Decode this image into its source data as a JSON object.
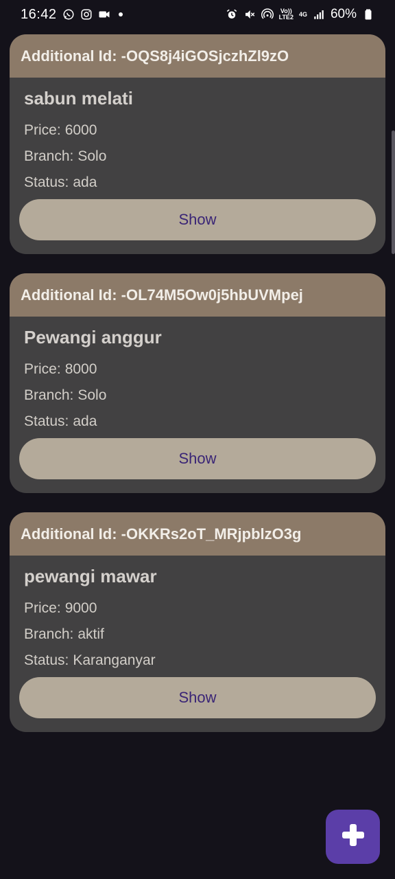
{
  "status_bar": {
    "time": "16:42",
    "network_top": "Vo))",
    "network_bottom": "LTE2",
    "network_gen": "4G",
    "battery": "60%",
    "left_icons": [
      "whatsapp-icon",
      "instagram-icon",
      "video-camera-icon",
      "notification-dot"
    ],
    "right_icons": [
      "alarm-icon",
      "mute-icon",
      "hotspot-icon",
      "signal-icon",
      "battery-icon"
    ]
  },
  "labels": {
    "additional_id": "Additional Id:",
    "price": "Price:",
    "branch": "Branch:",
    "status": "Status:",
    "show": "Show"
  },
  "items": [
    {
      "id": "-OQS8j4iGOSjczhZl9zO",
      "name": "sabun melati",
      "price": "6000",
      "branch": "Solo",
      "status": "ada"
    },
    {
      "id": "-OL74M5Ow0j5hbUVMpej",
      "name": "Pewangi anggur",
      "price": "8000",
      "branch": "Solo",
      "status": "ada"
    },
    {
      "id": "-OKKRs2oT_MRjpblzO3g",
      "name": "pewangi mawar",
      "price": "9000",
      "branch": "aktif",
      "status": "Karanganyar"
    }
  ],
  "fab": {
    "icon": "plus-icon"
  },
  "colors": {
    "background": "#14121a",
    "card": "#424142",
    "card_header": "#8c7a68",
    "button": "#b4aa9a",
    "button_text": "#3a2576",
    "fab": "#5b3ea8"
  }
}
